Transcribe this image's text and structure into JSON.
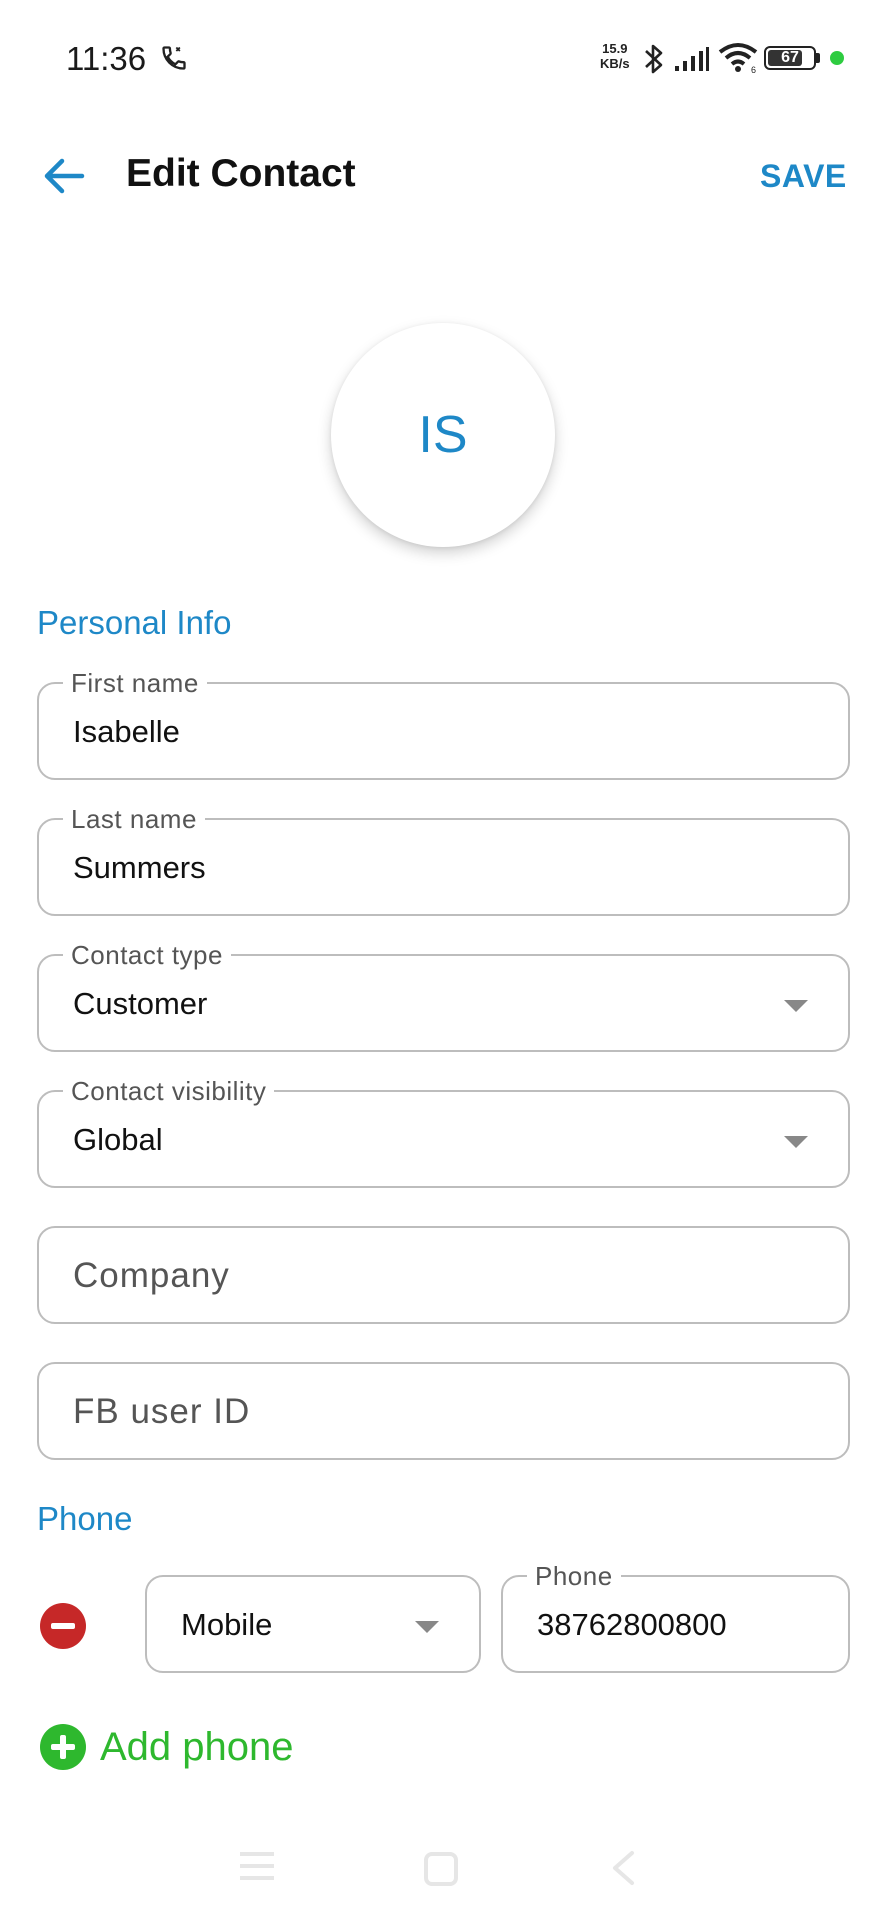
{
  "status_bar": {
    "time": "11:36",
    "net_speed_value": "15.9",
    "net_speed_unit": "KB/s",
    "battery_level": "67",
    "call_icon": "call-icon",
    "bluetooth_icon": "bluetooth-icon",
    "signal_icon": "signal-icon",
    "wifi_icon": "wifi-icon",
    "wifi_badge": "6"
  },
  "header": {
    "title": "Edit Contact",
    "save_label": "SAVE",
    "back_icon": "arrow-left-icon"
  },
  "avatar": {
    "initials": "IS"
  },
  "sections": {
    "personal_info": "Personal Info",
    "phone": "Phone"
  },
  "fields": {
    "first_name": {
      "label": "First name",
      "value": "Isabelle"
    },
    "last_name": {
      "label": "Last name",
      "value": "Summers"
    },
    "contact_type": {
      "label": "Contact type",
      "value": "Customer"
    },
    "contact_visibility": {
      "label": "Contact visibility",
      "value": "Global"
    },
    "company": {
      "placeholder": "Company"
    },
    "fb_user_id": {
      "placeholder": "FB user ID"
    }
  },
  "phone_entry": {
    "type": "Mobile",
    "label": "Phone",
    "value": "38762800800"
  },
  "add_phone_label": "Add phone",
  "colors": {
    "accent": "#1e88c7",
    "add": "#2eb82e",
    "remove": "#c62828"
  }
}
